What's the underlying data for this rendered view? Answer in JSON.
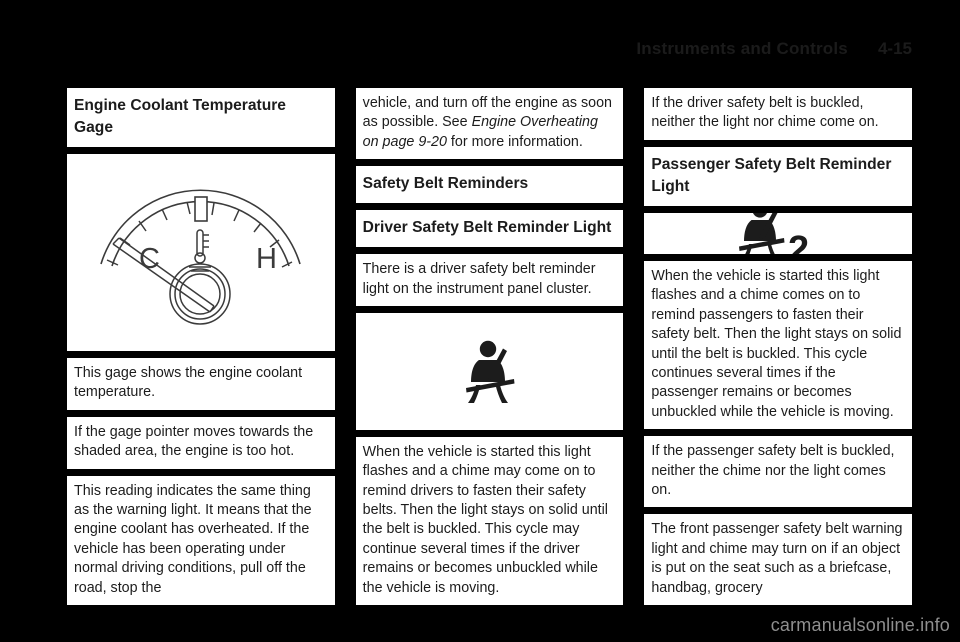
{
  "header": {
    "title": "Instruments and Controls",
    "page_number": "4-15"
  },
  "watermark": "carmanualsonline.info",
  "columns": [
    {
      "name": "left",
      "blocks": [
        {
          "kind": "heading",
          "name": "engine-coolant-temperature-gage-heading",
          "text": "Engine Coolant Temperature Gage"
        },
        {
          "kind": "figure",
          "name": "engine-coolant-temperature-gage-figure",
          "icon": "coolant-temperature-gauge-icon",
          "labels": {
            "cold": "C",
            "hot": "H"
          }
        },
        {
          "kind": "body",
          "name": "gage-description-paragraph",
          "text": "This gage shows the engine coolant temperature."
        },
        {
          "kind": "body",
          "name": "gage-pointer-paragraph",
          "text": "If the gage pointer moves towards the shaded area, the engine is too hot."
        },
        {
          "kind": "body",
          "name": "overheat-warning-paragraph",
          "text": "This reading indicates the same thing as the warning light. It means that the engine coolant has overheated. If the vehicle has been operating under normal driving conditions, pull off the road, stop the"
        }
      ]
    },
    {
      "name": "middle",
      "blocks": [
        {
          "kind": "body-rich",
          "name": "overheat-continuation-paragraph",
          "pre": "vehicle, and turn off the engine as soon as possible. See ",
          "italic": "Engine Overheating on page 9-20",
          "post": " for more information."
        },
        {
          "kind": "heading",
          "name": "safety-belt-reminders-heading",
          "text": "Safety Belt Reminders"
        },
        {
          "kind": "heading",
          "name": "driver-safety-belt-reminder-light-heading",
          "text": "Driver Safety Belt Reminder Light"
        },
        {
          "kind": "body",
          "name": "driver-reminder-light-location-paragraph",
          "text": "There is a driver safety belt reminder light on the instrument panel cluster."
        },
        {
          "kind": "figure",
          "name": "driver-safety-belt-reminder-light-figure",
          "icon": "seatbelt-person-icon"
        },
        {
          "kind": "body",
          "name": "driver-reminder-behavior-paragraph",
          "text": "When the vehicle is started this light flashes and a chime may come on to remind drivers to fasten their safety belts. Then the light stays on solid until the belt is buckled. This cycle may continue several times if the driver remains or becomes unbuckled while the vehicle is moving."
        }
      ]
    },
    {
      "name": "right",
      "blocks": [
        {
          "kind": "body",
          "name": "driver-belt-buckled-paragraph",
          "text": "If the driver safety belt is buckled, neither the light nor chime come on."
        },
        {
          "kind": "heading",
          "name": "passenger-safety-belt-reminder-light-heading",
          "text": "Passenger Safety Belt Reminder Light"
        },
        {
          "kind": "figure",
          "name": "passenger-safety-belt-reminder-light-figure",
          "icon": "seatbelt-person-2-icon",
          "badge": "2"
        },
        {
          "kind": "body",
          "name": "passenger-reminder-behavior-paragraph",
          "text": "When the vehicle is started this light flashes and a chime comes on to remind passengers to fasten their safety belt. Then the light stays on solid until the belt is buckled. This cycle continues several times if the passenger remains or becomes unbuckled while the vehicle is moving."
        },
        {
          "kind": "body",
          "name": "passenger-belt-buckled-paragraph",
          "text": "If the passenger safety belt is buckled, neither the chime nor the light comes on."
        },
        {
          "kind": "body",
          "name": "passenger-belt-object-paragraph",
          "text": "The front passenger safety belt warning light and chime may turn on if an object is put on the seat such as a briefcase, handbag, grocery"
        }
      ]
    }
  ]
}
